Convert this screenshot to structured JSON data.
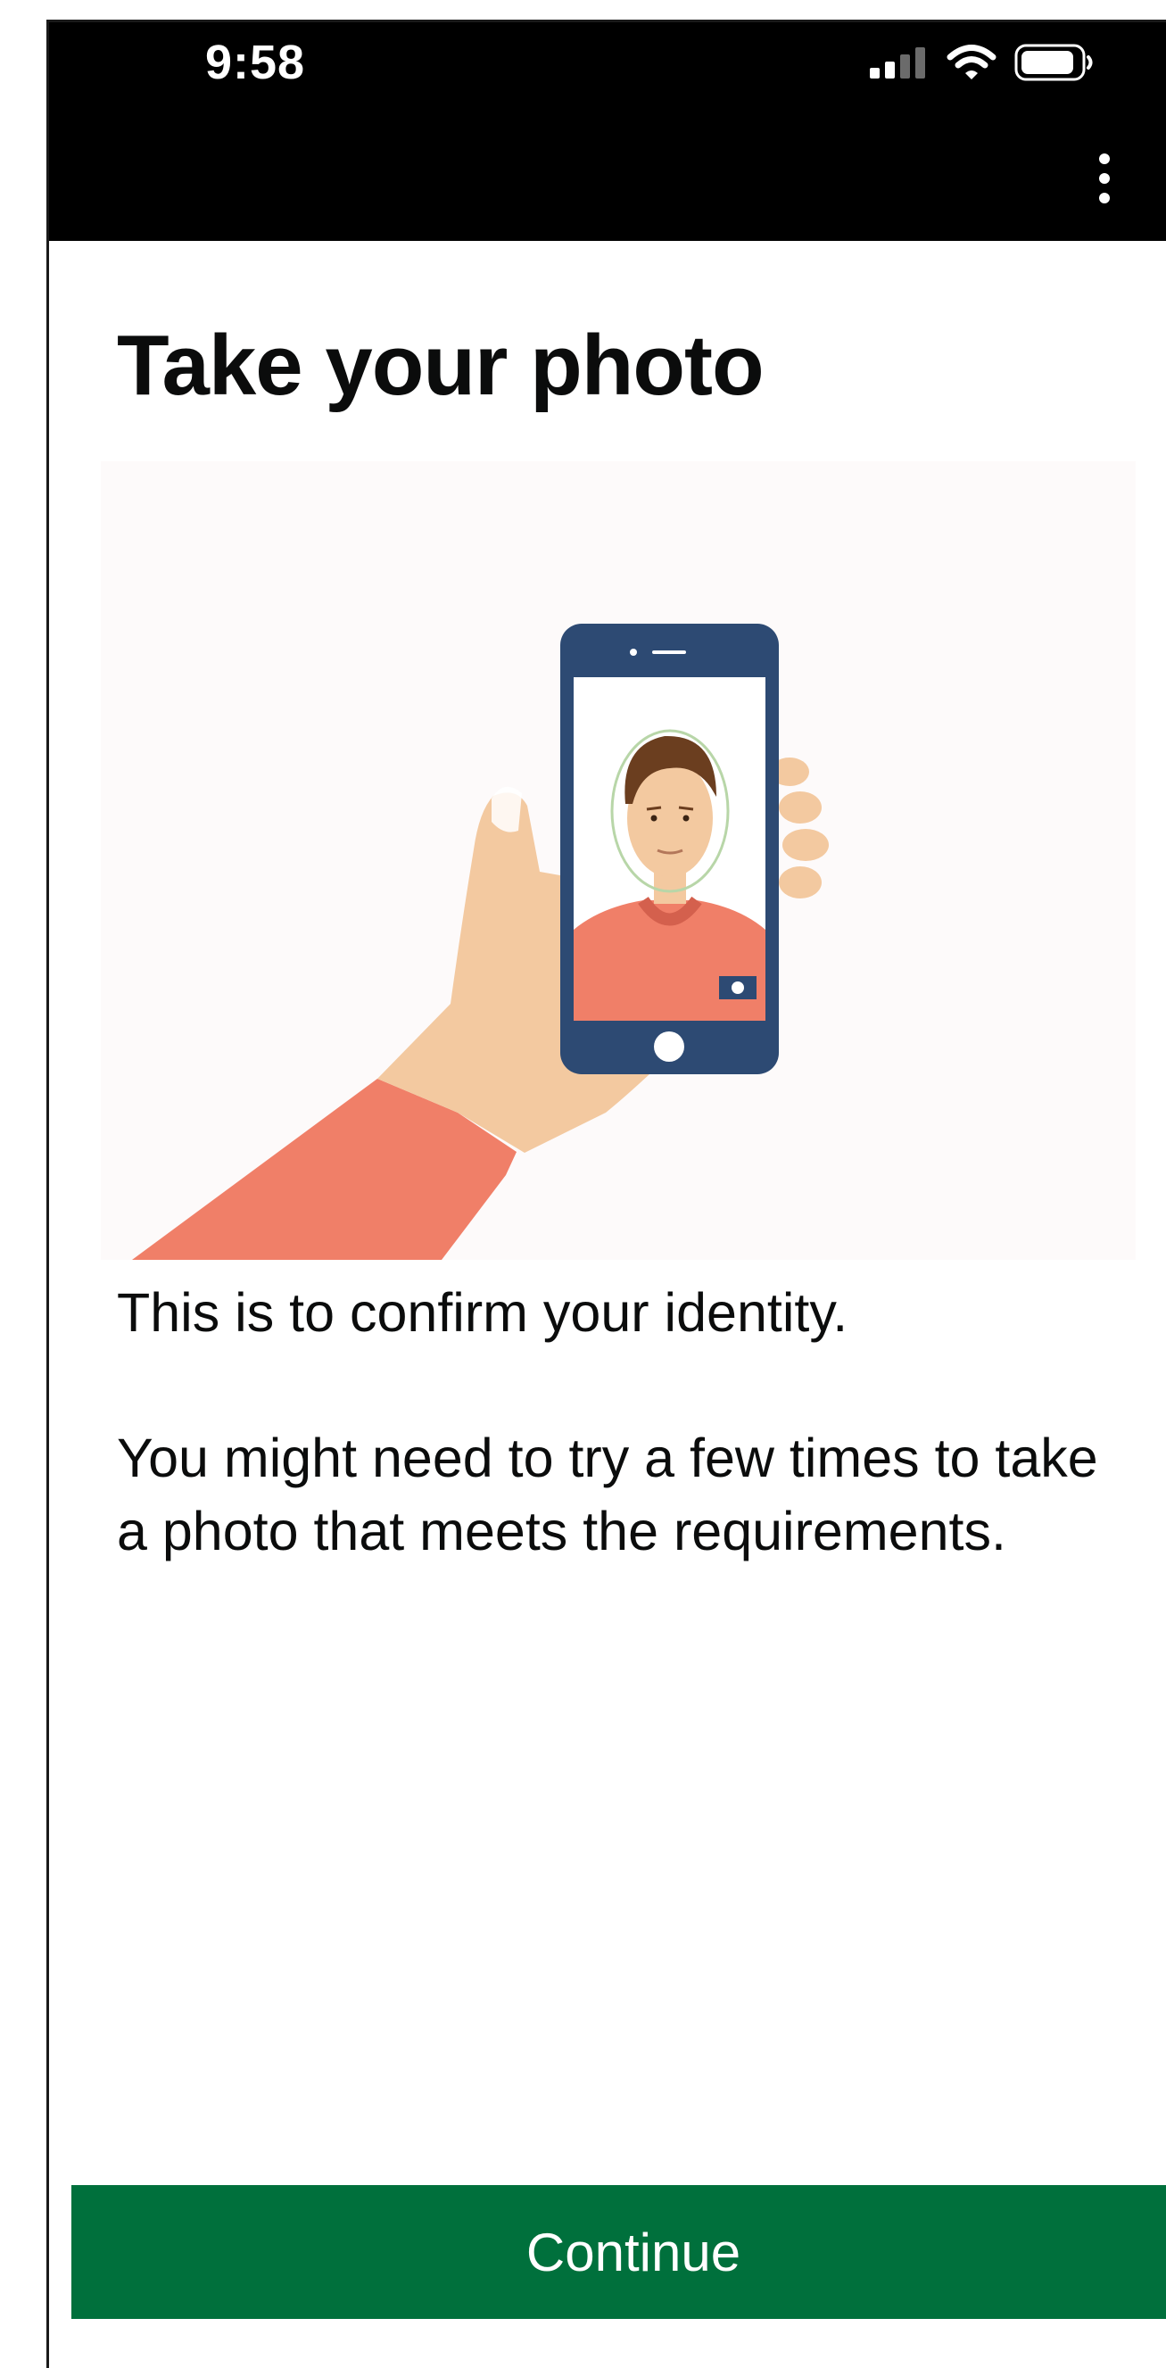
{
  "status_bar": {
    "time": "9:58"
  },
  "header": {
    "menu_icon": "more-vertical-icon"
  },
  "page": {
    "title": "Take your photo",
    "illustration_icon": "selfie-illustration",
    "paragraphs": [
      "This is to confirm your identity.",
      "You might need to try a few times to take a photo that meets the requirements."
    ]
  },
  "actions": {
    "continue_label": "Continue"
  },
  "colors": {
    "status_bar_bg": "#000000",
    "primary_button": "#00703c",
    "skin": "#f3c9a0",
    "shirt": "#f07f68",
    "phone_body": "#2d4a73"
  }
}
